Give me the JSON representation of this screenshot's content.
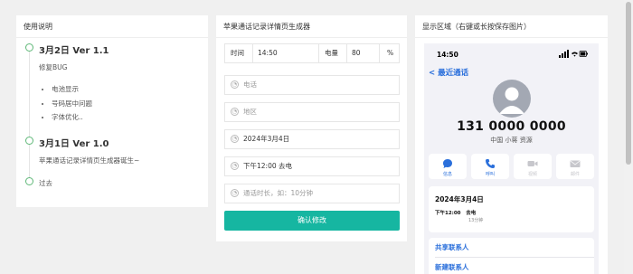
{
  "left": {
    "title": "使用说明",
    "v1": {
      "title": "3月2日 Ver 1.1",
      "text": "修复BUG",
      "items": [
        "电池显示",
        "号码居中问题",
        "字体优化.."
      ]
    },
    "v2": {
      "title": "3月1日 Ver 1.0",
      "text": "苹果通话记录详情页生成器诞生~"
    },
    "past": "过去"
  },
  "mid": {
    "title": "苹果通话记录详情页生成器",
    "time_label": "时间",
    "time_value": "14:50",
    "battery_label": "电量",
    "battery_value": "80",
    "percent": "%",
    "phone_placeholder": "电话",
    "region_placeholder": "地区",
    "date_value": "2024年3月4日",
    "call_value": "下午12:00  去电",
    "duration_placeholder": "通话时长，如：10分钟",
    "confirm": "确认修改"
  },
  "right": {
    "title": "显示区域（右键或长按保存图片）",
    "status_time": "14:50",
    "back": "最近通话",
    "number": "131 0000 0000",
    "carrier": "中国 小蒋 资源",
    "actions": [
      {
        "label": "信息",
        "icon": "message-icon"
      },
      {
        "label": "呼叫",
        "icon": "phone-icon"
      },
      {
        "label": "视频",
        "icon": "video-icon"
      },
      {
        "label": "邮件",
        "icon": "mail-icon"
      }
    ],
    "card_date": "2024年3月4日",
    "card_time": "下午12:00",
    "card_type": "去电",
    "card_duration": "13分钟",
    "share": "共享联系人",
    "new_contact": "新建联系人"
  },
  "colors": {
    "accent": "#16b6a1",
    "timeline": "#5fb878",
    "ios_blue": "#2a6fdb"
  }
}
